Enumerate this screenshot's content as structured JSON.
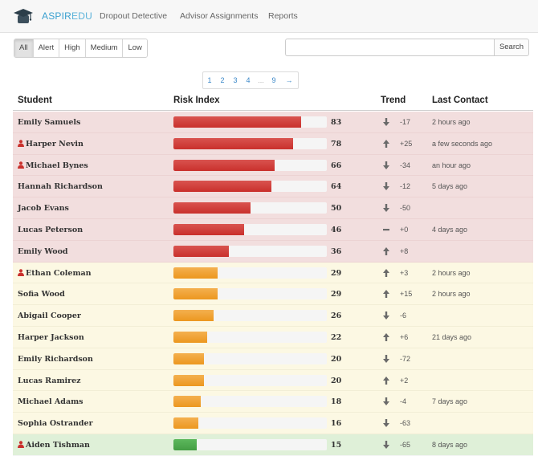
{
  "nav": {
    "brand_prefix": "ASPIR",
    "brand_suffix": "EDU",
    "links": [
      "Dropout Detective",
      "Advisor Assignments",
      "Reports"
    ]
  },
  "filters": [
    "All",
    "Alert",
    "High",
    "Medium",
    "Low"
  ],
  "filters_active": "All",
  "search": {
    "value": "",
    "placeholder": "",
    "button": "Search"
  },
  "pagination": {
    "pages": [
      "1",
      "2",
      "3",
      "4",
      "...",
      "9",
      "→"
    ],
    "current": "1"
  },
  "table": {
    "headers": {
      "student": "Student",
      "risk": "Risk Index",
      "trend": "Trend",
      "contact": "Last Contact"
    },
    "colors": {
      "red": "#f2dede",
      "yellow": "#fcf8e3",
      "green": "#dff0d8"
    },
    "rows": [
      {
        "name": "Emily Samuels",
        "alert": false,
        "risk": 83,
        "trend_dir": "down",
        "trend": "-17",
        "contact": "2 hours ago",
        "level": "red"
      },
      {
        "name": "Harper Nevin",
        "alert": true,
        "risk": 78,
        "trend_dir": "up",
        "trend": "+25",
        "contact": "a few seconds ago",
        "level": "red"
      },
      {
        "name": "Michael Bynes",
        "alert": true,
        "risk": 66,
        "trend_dir": "down",
        "trend": "-34",
        "contact": "an hour ago",
        "level": "red"
      },
      {
        "name": "Hannah Richardson",
        "alert": false,
        "risk": 64,
        "trend_dir": "down",
        "trend": "-12",
        "contact": "5 days ago",
        "level": "red"
      },
      {
        "name": "Jacob Evans",
        "alert": false,
        "risk": 50,
        "trend_dir": "down",
        "trend": "-50",
        "contact": "",
        "level": "red"
      },
      {
        "name": "Lucas Peterson",
        "alert": false,
        "risk": 46,
        "trend_dir": "flat",
        "trend": "+0",
        "contact": "4 days ago",
        "level": "red"
      },
      {
        "name": "Emily Wood",
        "alert": false,
        "risk": 36,
        "trend_dir": "up",
        "trend": "+8",
        "contact": "",
        "level": "red"
      },
      {
        "name": "Ethan Coleman",
        "alert": true,
        "risk": 29,
        "trend_dir": "up",
        "trend": "+3",
        "contact": "2 hours ago",
        "level": "yellow"
      },
      {
        "name": "Sofia Wood",
        "alert": false,
        "risk": 29,
        "trend_dir": "up",
        "trend": "+15",
        "contact": "2 hours ago",
        "level": "yellow"
      },
      {
        "name": "Abigail Cooper",
        "alert": false,
        "risk": 26,
        "trend_dir": "down",
        "trend": "-6",
        "contact": "",
        "level": "yellow"
      },
      {
        "name": "Harper Jackson",
        "alert": false,
        "risk": 22,
        "trend_dir": "up",
        "trend": "+6",
        "contact": "21 days ago",
        "level": "yellow"
      },
      {
        "name": "Emily Richardson",
        "alert": false,
        "risk": 20,
        "trend_dir": "down",
        "trend": "-72",
        "contact": "",
        "level": "yellow"
      },
      {
        "name": "Lucas Ramirez",
        "alert": false,
        "risk": 20,
        "trend_dir": "up",
        "trend": "+2",
        "contact": "",
        "level": "yellow"
      },
      {
        "name": "Michael Adams",
        "alert": false,
        "risk": 18,
        "trend_dir": "down",
        "trend": "-4",
        "contact": "7 days ago",
        "level": "yellow"
      },
      {
        "name": "Sophia Ostrander",
        "alert": false,
        "risk": 16,
        "trend_dir": "down",
        "trend": "-63",
        "contact": "",
        "level": "yellow"
      },
      {
        "name": "Aiden Tishman",
        "alert": true,
        "risk": 15,
        "trend_dir": "down",
        "trend": "-65",
        "contact": "8 days ago",
        "level": "green"
      }
    ]
  }
}
